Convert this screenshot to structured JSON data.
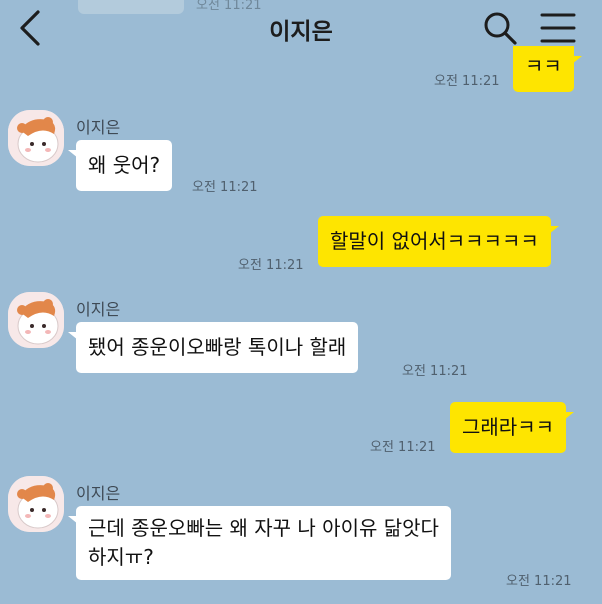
{
  "header": {
    "title": "이지은",
    "faded_time": "오전 11:21"
  },
  "messages": [
    {
      "side": "out",
      "text": "ㅋㅋ",
      "time": "오전 11:21"
    },
    {
      "side": "in",
      "sender": "이지은",
      "text": "왜 웃어?",
      "time": "오전 11:21"
    },
    {
      "side": "out",
      "text": "할말이 없어서ㅋㅋㅋㅋㅋ",
      "time": "오전 11:21"
    },
    {
      "side": "in",
      "sender": "이지은",
      "text": "됐어 종운이오빠랑 톡이나 할래",
      "time": "오전 11:21"
    },
    {
      "side": "out",
      "text": "그래라ㅋㅋ",
      "time": "오전 11:21"
    },
    {
      "side": "in",
      "sender": "이지은",
      "text_line1": "근데 종운오빠는 왜 자꾸 나 아이유 닮앗다",
      "text_line2": "하지ㅠ?",
      "time": "오전 11:21"
    }
  ],
  "colors": {
    "background": "#9bbbd4",
    "incoming_bubble": "#ffffff",
    "outgoing_bubble": "#fee500"
  },
  "icons": [
    "back-arrow-icon",
    "search-icon",
    "menu-icon"
  ]
}
